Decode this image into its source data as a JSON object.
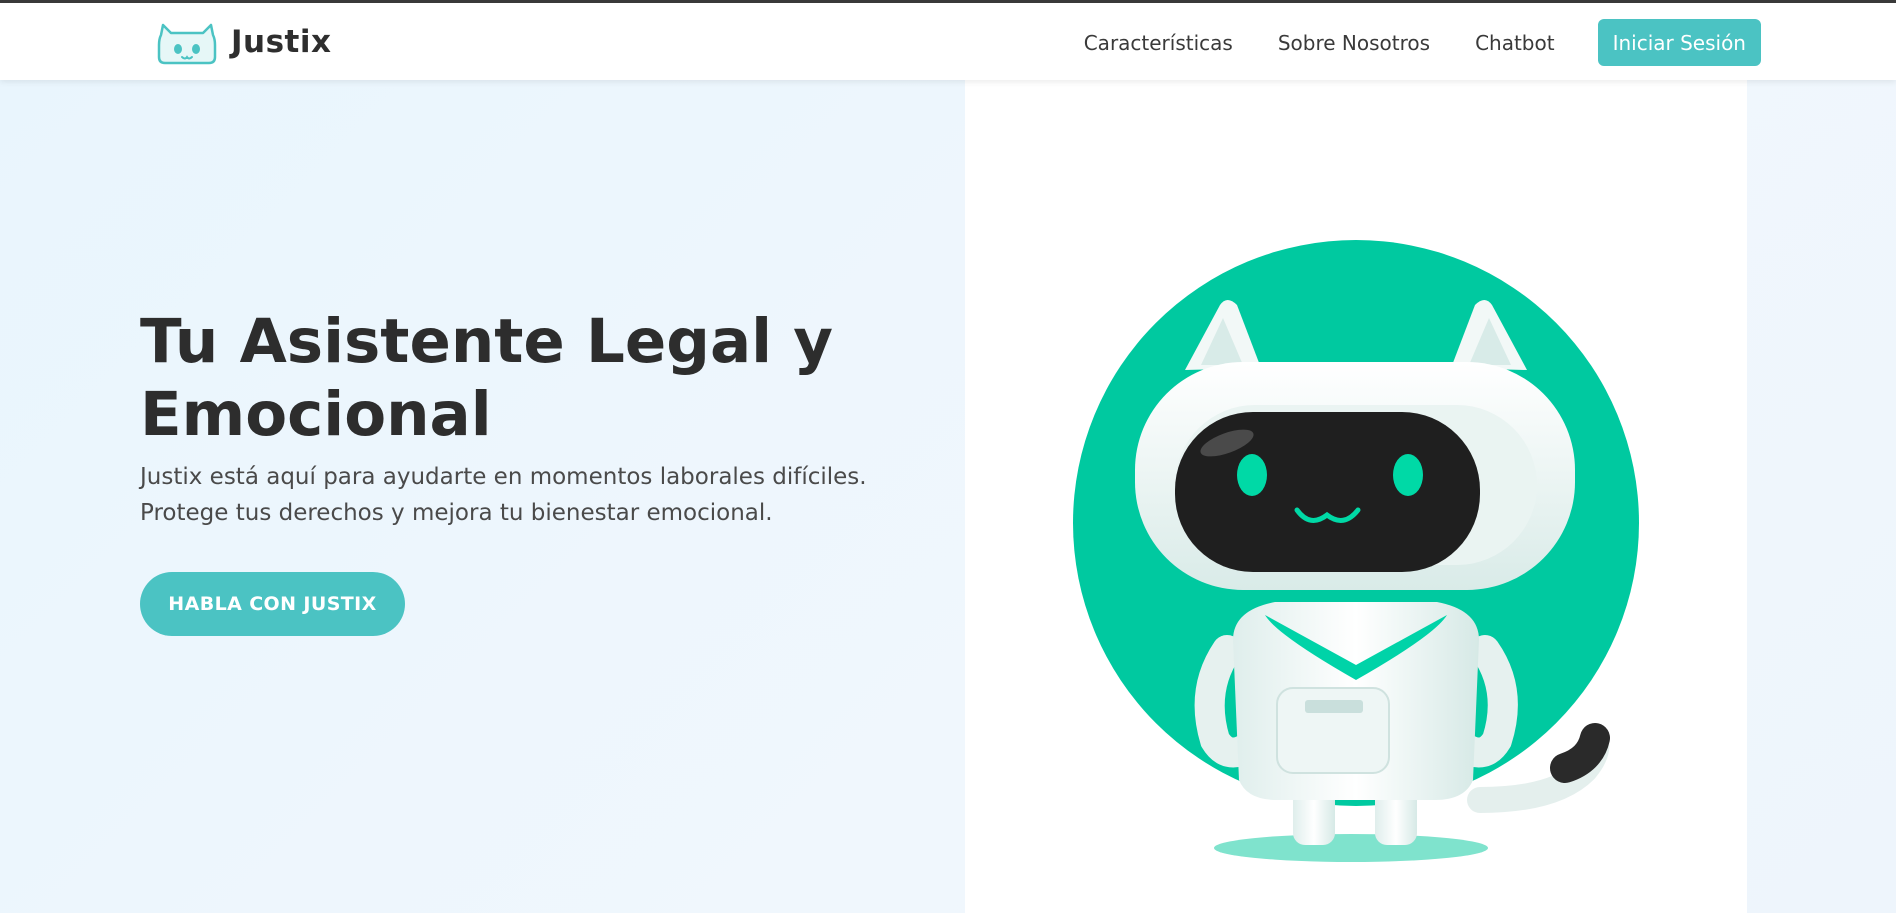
{
  "header": {
    "brand_name": "Justix",
    "nav": [
      "Características",
      "Sobre Nosotros",
      "Chatbot"
    ],
    "login_label": "Iniciar Sesión"
  },
  "hero": {
    "title_line1": "Tu Asistente Legal y",
    "title_line2": "Emocional",
    "subtitle_line1": "Justix está aquí para ayudarte en momentos laborales difíciles.",
    "subtitle_line2": "Protege tus derechos y mejora tu bienestar emocional.",
    "cta_label": "HABLA CON JUSTIX",
    "illustration": "robot-cat-mascot"
  },
  "colors": {
    "accent": "#4bc3c3",
    "mascot_green": "#00c9a0",
    "text_dark": "#2d2d2d"
  },
  "icons": [
    "justix-cat-logo-icon"
  ]
}
